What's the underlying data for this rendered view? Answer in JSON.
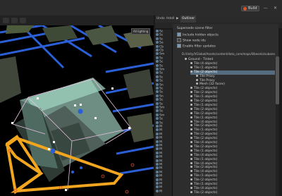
{
  "titlebar": {
    "build_label": "Build",
    "minimize_glyph": "—",
    "close_glyph": "✕"
  },
  "viewport": {
    "label": "All lighting"
  },
  "panel": {
    "tabs": [
      "Undo",
      "Hdoll",
      "▶",
      "Outliner"
    ],
    "left_col_items": [
      "Sc",
      "Sc",
      "Sc",
      "Se",
      "Cb",
      "Cb",
      "Sm",
      "Sc",
      "Sc",
      "Sc",
      "Sm",
      "Sc",
      "Sc",
      "Sc",
      "Sn",
      "Sc",
      "Sc",
      "Sn",
      "Sc",
      "Sc",
      "Sm",
      "Sc",
      "Sm",
      "Sc",
      "Sc",
      "M",
      "M",
      "M",
      "M",
      "M",
      "M",
      "M",
      "M",
      "M",
      "M",
      "M",
      "M",
      "M",
      "M",
      "M",
      "M",
      "M",
      "M"
    ],
    "options": {
      "filter_heading": "Supersede scene filter",
      "include_hidden": "Include hidden objects",
      "show_node_ids": "Show node ids",
      "live_filter": "Enable filter updates"
    },
    "path": "D:/Unity/VGlobal/Assets/content/data_core/maps/lilbeanlo/subarea_basic.vmap",
    "tree": [
      {
        "label": "Ground - Tinted",
        "indent": 0
      },
      {
        "label": "Tile (4 objects)",
        "indent": 1
      },
      {
        "label": "Tile (1 objects)",
        "indent": 1
      },
      {
        "label": "Tile (2 objects)",
        "indent": 1,
        "selected": true
      },
      {
        "label": "Tile Proxy",
        "indent": 2
      },
      {
        "label": "Tile Proxy",
        "indent": 2
      },
      {
        "label": "Mesh (32 faces)",
        "indent": 2
      },
      {
        "label": "Tile (2 objects)",
        "indent": 1
      },
      {
        "label": "Tile (2 objects)",
        "indent": 1
      },
      {
        "label": "Tile (1 objects)",
        "indent": 1
      },
      {
        "label": "Tile (2 objects)",
        "indent": 1
      },
      {
        "label": "Tile (1 objects)",
        "indent": 1
      },
      {
        "label": "Tile (2 objects)",
        "indent": 1
      },
      {
        "label": "Tile (2 objects)",
        "indent": 1
      },
      {
        "label": "Tile (1 objects)",
        "indent": 1
      },
      {
        "label": "Tile (4 objects)",
        "indent": 1
      },
      {
        "label": "Tile (2 objects)",
        "indent": 1
      },
      {
        "label": "Tile (1 objects)",
        "indent": 1
      },
      {
        "label": "Tile (2 objects)",
        "indent": 1
      },
      {
        "label": "Tile (2 objects)",
        "indent": 1
      },
      {
        "label": "Tile (4 objects)",
        "indent": 1
      },
      {
        "label": "Tile (2 objects)",
        "indent": 1
      },
      {
        "label": "Tile (1 objects)",
        "indent": 1
      },
      {
        "label": "Tile (4 objects)",
        "indent": 1
      },
      {
        "label": "Tile (1 objects)",
        "indent": 1
      },
      {
        "label": "Tile (4 objects)",
        "indent": 1
      },
      {
        "label": "Tile (2 objects)",
        "indent": 1
      },
      {
        "label": "Tile (4 objects)",
        "indent": 1
      },
      {
        "label": "Tile (1 objects)",
        "indent": 1
      },
      {
        "label": "Tile (2 objects)",
        "indent": 1
      },
      {
        "label": "Tile (1 objects)",
        "indent": 1
      },
      {
        "label": "Tile (4 objects)",
        "indent": 1
      },
      {
        "label": "Tile (2 objects)",
        "indent": 1
      }
    ]
  },
  "colors": {
    "accent": "#d9532c",
    "selection": "#556b80",
    "gizmo_blue": "#2b5fd6",
    "bounds_orange": "#f2a51f",
    "mesh_green": "#8fbfa7"
  }
}
